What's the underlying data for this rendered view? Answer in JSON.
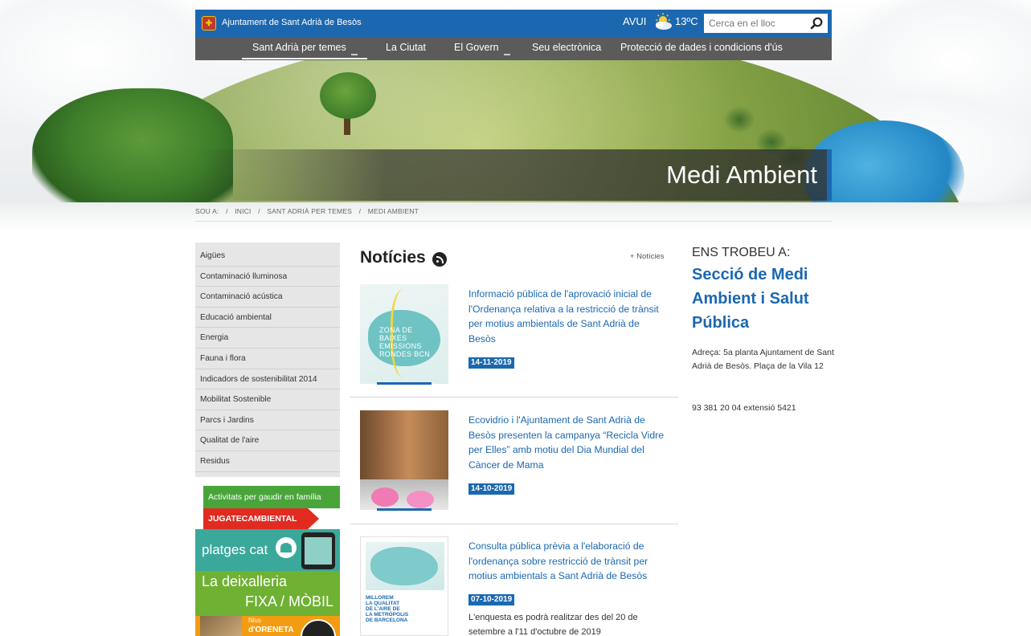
{
  "header": {
    "site_name": "Ajuntament de Sant Adrià de Besòs",
    "logo_glyph": "✚",
    "weather_label": "AVUI",
    "temperature": "13ºC",
    "search_placeholder": "Cerca en el lloc",
    "accent_color": "#1b68b0"
  },
  "nav": {
    "items": [
      {
        "label": "Sant Adrià per temes",
        "has_dropdown": true,
        "active": true
      },
      {
        "label": "La Ciutat",
        "has_dropdown": false,
        "active": false
      },
      {
        "label": "El Govern",
        "has_dropdown": true,
        "active": false
      },
      {
        "label": "Seu electrònica",
        "has_dropdown": false,
        "active": false
      },
      {
        "label": "Protecció de dades i condicions d'ús",
        "has_dropdown": false,
        "active": false
      }
    ]
  },
  "hero": {
    "title": "Medi Ambient"
  },
  "breadcrumb": {
    "prefix": "SOU A:",
    "separator": "/",
    "items": [
      "INICI",
      "SANT ADRIÀ PER TEMES",
      "MEDI AMBIENT"
    ]
  },
  "sidebar": {
    "items": [
      "Aigües",
      "Contaminació lluminosa",
      "Contaminació acústica",
      "Educació ambiental",
      "Energia",
      "Fauna i flora",
      "Indicadors de sostenibilitat 2014",
      "Mobilitat Sostenible",
      "Parcs i Jardins",
      "Qualitat de l'aire",
      "Residus"
    ]
  },
  "banners": {
    "family_activities": "Activitats per gaudir en família",
    "jugatec": "JUGATECAMBIENTAL",
    "platges": "platges cat",
    "deixalleria_line1": "La deixalleria",
    "deixalleria_line2": "FIXA / MÒBIL",
    "nius_line1": "Nius",
    "nius_line2": "d'ORENETA"
  },
  "news": {
    "title": "Notícies",
    "more_label": "+ Notícies",
    "items": [
      {
        "title": "Informació pública de l'aprovació inicial de l'Ordenança relativa a la restricció de trànsit per motius ambientals de Sant Adrià de Besòs",
        "date": "14-11-2019",
        "image_text": "ZONA DE\nBAIXES\nEMISSIONS\nRONDES BCN"
      },
      {
        "title": "Ecovidrio i l'Ajuntament de Sant Adrià de Besòs presenten la campanya “Recicla Vidre per Elles” amb motiu del Dia Mundial del Càncer de Mama",
        "date": "14-10-2019"
      },
      {
        "title": "Consulta pública prèvia a l'elaboració de l'ordenança sobre restricció de trànsit per motius ambientals a Sant Adrià de Besòs",
        "date": "07-10-2019",
        "summary": "L'enquesta es podrà realitzar des del 20 de setembre a l'11 d'octubre de 2019",
        "image_text": "MILLOREM\nLA QUALITAT\nDE L'AIRE DE\nLA METRÒPOLIS\nDE BARCELONA"
      }
    ]
  },
  "contact": {
    "heading": "ENS TROBEU A:",
    "department": "Secció de Medi Ambient i Salut Pública",
    "address": "Adreça: 5a planta Ajuntament de Sant Adrià de Besòs. Plaça de la Vila 12",
    "phone": "93 381 20 04 extensió 5421"
  }
}
